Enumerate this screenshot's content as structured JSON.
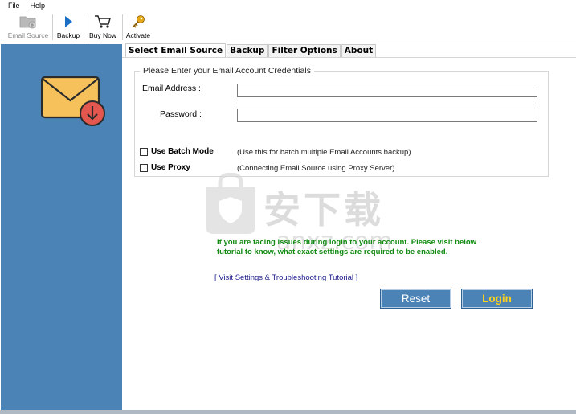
{
  "menu": {
    "items": [
      "File",
      "Help"
    ]
  },
  "toolbar": {
    "buttons": [
      {
        "label": "Email Source",
        "icon": "folder-icon",
        "enabled": false
      },
      {
        "label": "Backup",
        "icon": "play-arrow-icon",
        "enabled": true
      },
      {
        "label": "Buy Now",
        "icon": "cart-icon",
        "enabled": true
      },
      {
        "label": "Activate",
        "icon": "key-icon",
        "enabled": true
      }
    ]
  },
  "tabs": [
    "Select Email Source",
    "Backup",
    "Filter Options",
    "About"
  ],
  "credentials": {
    "group_title": "Please Enter your Email Account Credentials",
    "email_label": "Email Address :",
    "email_value": "",
    "password_label": "Password :",
    "password_value": ""
  },
  "options": {
    "batch": {
      "label": "Use Batch Mode",
      "checked": false,
      "hint": "(Use this for batch multiple Email Accounts backup)"
    },
    "proxy": {
      "label": "Use Proxy",
      "checked": false,
      "hint": "(Connecting Email Source using Proxy Server)"
    }
  },
  "notice": "If you are facing issues during login to your account. Please visit below tutorial to know, what exact settings are required to be enabled.",
  "tutorial_link": "[ Visit Settings & Troubleshooting Tutorial ]",
  "actions": {
    "reset_label": "Reset",
    "login_label": "Login"
  },
  "watermark": {
    "cn": "安下载",
    "en": "anxz.com"
  },
  "colors": {
    "panel": "#4b83b7",
    "login_text": "#ffd21a",
    "notice": "#108a10",
    "link": "#1a1a8a"
  }
}
